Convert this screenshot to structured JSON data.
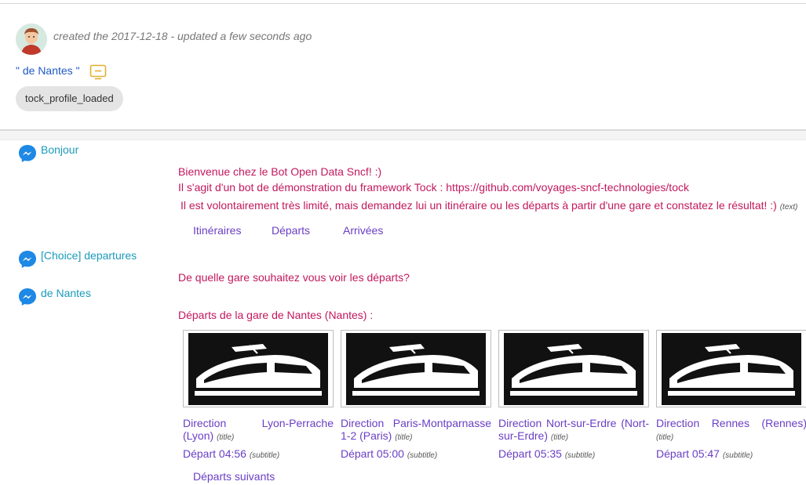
{
  "header": {
    "meta": "created the 2017-12-18 - updated a few seconds ago",
    "dialog_title": "\" de Nantes \"",
    "tag": "tock_profile_loaded"
  },
  "conversation": {
    "user1": "Bonjour",
    "bot1_line1": "Bienvenue chez le Bot Open Data Sncf! :)",
    "bot1_line2": "Il s'agit d'un bot de démonstration du framework Tock : https://github.com/voyages-sncf-technologies/tock",
    "bot1_line3": "Il est volontairement très limité, mais demandez lui un itinéraire ou les départs à partir d'une gare et constatez le résultat! :)",
    "text_hint": "(text)",
    "quick_replies": [
      "Itinéraires",
      "Départs",
      "Arrivées"
    ],
    "user2": "[Choice] departures",
    "bot2": "De quelle gare souhaitez vous voir les départs?",
    "user3": "de Nantes",
    "bot3": "Départs de la gare de Nantes (Nantes) :",
    "title_hint": "(title)",
    "subtitle_hint": "(subtitle)",
    "cards": [
      {
        "title": "Direction Lyon-Perrache (Lyon)",
        "subtitle": "Départ 04:56"
      },
      {
        "title": "Direction Paris-Montparnasse 1-2 (Paris)",
        "subtitle": "Départ 05:00"
      },
      {
        "title": "Direction Nort-sur-Erdre (Nort-sur-Erdre)",
        "subtitle": "Départ 05:35"
      },
      {
        "title": "Direction Rennes (Rennes)",
        "subtitle": "Départ 05:47"
      }
    ],
    "next_button": "Départs suivants"
  },
  "icons": {
    "avatar": "user-avatar-icon",
    "display": "tv-display-icon",
    "messenger": "messenger-icon",
    "train": "train-image"
  },
  "colors": {
    "user_text": "#1a9bbb",
    "bot_text": "#c2185b",
    "buttons": "#6a3fc4",
    "title_link": "#1f58c4"
  }
}
